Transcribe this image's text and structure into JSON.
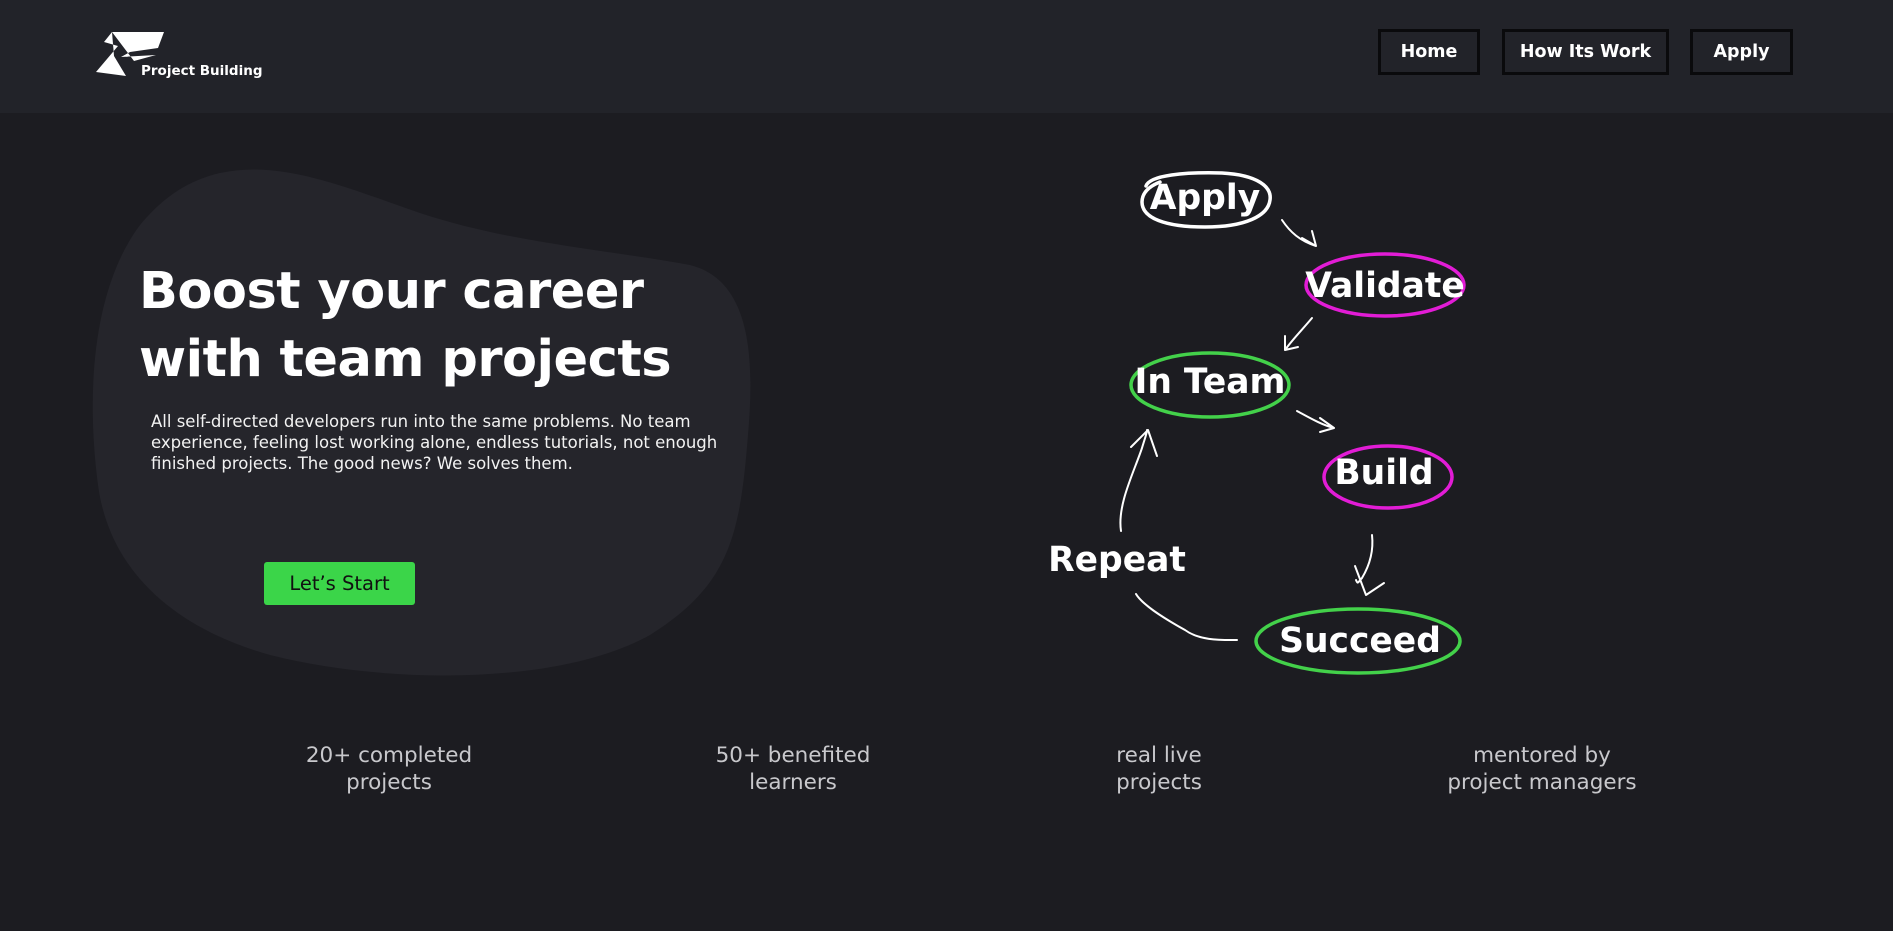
{
  "header": {
    "logo_text": "Project Building",
    "nav": [
      {
        "label": "Home"
      },
      {
        "label": "How Its Work"
      },
      {
        "label": "Apply"
      }
    ]
  },
  "hero": {
    "title_line1": "Boost your career",
    "title_line2": "with team projects",
    "description": "All self-directed developers run into the same problems. No team experience, feeling lost working alone, endless tutorials, not enough finished projects. The good news? We solves them.",
    "cta_label": "Let’s Start"
  },
  "diagram": {
    "steps": [
      {
        "label": "Apply",
        "color": "#ffffff"
      },
      {
        "label": "Validate",
        "color": "#e21cd6"
      },
      {
        "label": "In Team",
        "color": "#43d14a"
      },
      {
        "label": "Build",
        "color": "#e21cd6"
      },
      {
        "label": "Succeed",
        "color": "#43d14a"
      },
      {
        "label": "Repeat",
        "color": "none"
      }
    ]
  },
  "stats": [
    {
      "line1": "20+ completed",
      "line2": "projects"
    },
    {
      "line1": "50+ benefited",
      "line2": "learners"
    },
    {
      "line1": "real live",
      "line2": "projects"
    },
    {
      "line1": "mentored by",
      "line2": "project managers"
    }
  ],
  "colors": {
    "background": "#1c1c21",
    "header": "#222329",
    "accent_green": "#3bd549",
    "accent_magenta": "#e21cd6"
  }
}
